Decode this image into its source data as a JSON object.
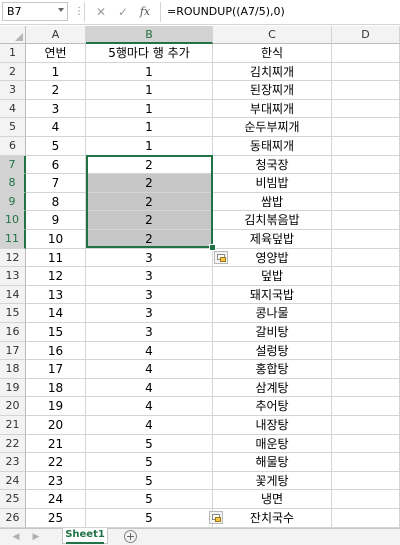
{
  "formula_bar": {
    "name_box": "B7",
    "formula": "=ROUNDUP((A7/5),0)",
    "fx_label": "fx",
    "cancel_glyph": "✕",
    "enter_glyph": "✓"
  },
  "columns": [
    "A",
    "B",
    "C",
    "D"
  ],
  "rows": [
    {
      "num": "1",
      "a": "연번",
      "b": "5행마다 행 추가",
      "c": "한식"
    },
    {
      "num": "2",
      "a": "1",
      "b": "1",
      "c": "김치찌개"
    },
    {
      "num": "3",
      "a": "2",
      "b": "1",
      "c": "된장찌개"
    },
    {
      "num": "4",
      "a": "3",
      "b": "1",
      "c": "부대찌개"
    },
    {
      "num": "5",
      "a": "4",
      "b": "1",
      "c": "순두부찌개"
    },
    {
      "num": "6",
      "a": "5",
      "b": "1",
      "c": "동태찌개"
    },
    {
      "num": "7",
      "a": "6",
      "b": "2",
      "c": "청국장"
    },
    {
      "num": "8",
      "a": "7",
      "b": "2",
      "c": "비빔밥"
    },
    {
      "num": "9",
      "a": "8",
      "b": "2",
      "c": "쌈밥"
    },
    {
      "num": "10",
      "a": "9",
      "b": "2",
      "c": "김치볶음밥"
    },
    {
      "num": "11",
      "a": "10",
      "b": "2",
      "c": "제육덮밥"
    },
    {
      "num": "12",
      "a": "11",
      "b": "3",
      "c": "영양밥"
    },
    {
      "num": "13",
      "a": "12",
      "b": "3",
      "c": "덮밥"
    },
    {
      "num": "14",
      "a": "13",
      "b": "3",
      "c": "돼지국밥"
    },
    {
      "num": "15",
      "a": "14",
      "b": "3",
      "c": "콩나물"
    },
    {
      "num": "16",
      "a": "15",
      "b": "3",
      "c": "갈비탕"
    },
    {
      "num": "17",
      "a": "16",
      "b": "4",
      "c": "설렁탕"
    },
    {
      "num": "18",
      "a": "17",
      "b": "4",
      "c": "홍합탕"
    },
    {
      "num": "19",
      "a": "18",
      "b": "4",
      "c": "삼계탕"
    },
    {
      "num": "20",
      "a": "19",
      "b": "4",
      "c": "추어탕"
    },
    {
      "num": "21",
      "a": "20",
      "b": "4",
      "c": "내장탕"
    },
    {
      "num": "22",
      "a": "21",
      "b": "5",
      "c": "매운탕"
    },
    {
      "num": "23",
      "a": "22",
      "b": "5",
      "c": "해물탕"
    },
    {
      "num": "24",
      "a": "23",
      "b": "5",
      "c": "꽃게탕"
    },
    {
      "num": "25",
      "a": "24",
      "b": "5",
      "c": "냉면"
    },
    {
      "num": "26",
      "a": "25",
      "b": "5",
      "c": "잔치국수"
    }
  ],
  "sheet_tabs": {
    "active": "Sheet1",
    "add_glyph": "+",
    "nav_prev": "◀",
    "nav_next": "▶"
  },
  "colors": {
    "selection": "#217346",
    "selected_fill": "#c6c6c6",
    "header_fill": "#f3f3f3"
  }
}
